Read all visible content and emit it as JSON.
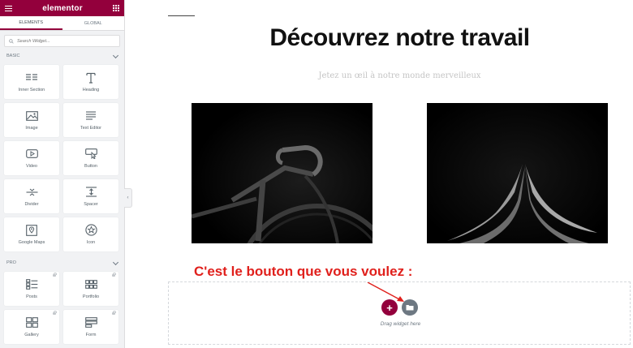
{
  "sidebar": {
    "brand": "elementor",
    "tabs": [
      {
        "label": "ELEMENTS",
        "active": true
      },
      {
        "label": "GLOBAL",
        "active": false
      }
    ],
    "search_placeholder": "Search Widget...",
    "sections": [
      {
        "label": "BASIC",
        "widgets": [
          {
            "label": "Inner Section",
            "icon": "inner-section-icon"
          },
          {
            "label": "Heading",
            "icon": "heading-icon"
          },
          {
            "label": "Image",
            "icon": "image-icon"
          },
          {
            "label": "Text Editor",
            "icon": "text-editor-icon"
          },
          {
            "label": "Video",
            "icon": "video-icon"
          },
          {
            "label": "Button",
            "icon": "button-icon"
          },
          {
            "label": "Divider",
            "icon": "divider-icon"
          },
          {
            "label": "Spacer",
            "icon": "spacer-icon"
          },
          {
            "label": "Google Maps",
            "icon": "google-maps-icon"
          },
          {
            "label": "Icon",
            "icon": "star-icon"
          }
        ]
      },
      {
        "label": "PRO",
        "widgets": [
          {
            "label": "Posts",
            "icon": "posts-icon",
            "locked": true
          },
          {
            "label": "Portfolio",
            "icon": "portfolio-icon",
            "locked": true
          },
          {
            "label": "Gallery",
            "icon": "gallery-icon",
            "locked": true
          },
          {
            "label": "Form",
            "icon": "form-icon",
            "locked": true
          }
        ]
      }
    ]
  },
  "canvas": {
    "title": "Découvrez notre travail",
    "subtitle": "Jetez un œil à notre monde merveilleux",
    "images": [
      {
        "name": "bicycle-photo",
        "desc_icon": "bicycle-photo"
      },
      {
        "name": "hands-photo",
        "desc_icon": "hands-photo"
      }
    ],
    "annotation": "C'est le bouton que vous voulez :",
    "drag_text": "Drag widget here"
  },
  "colors": {
    "brand": "#93003c",
    "annotation": "#e0201c",
    "folder_button": "#6d7882"
  }
}
